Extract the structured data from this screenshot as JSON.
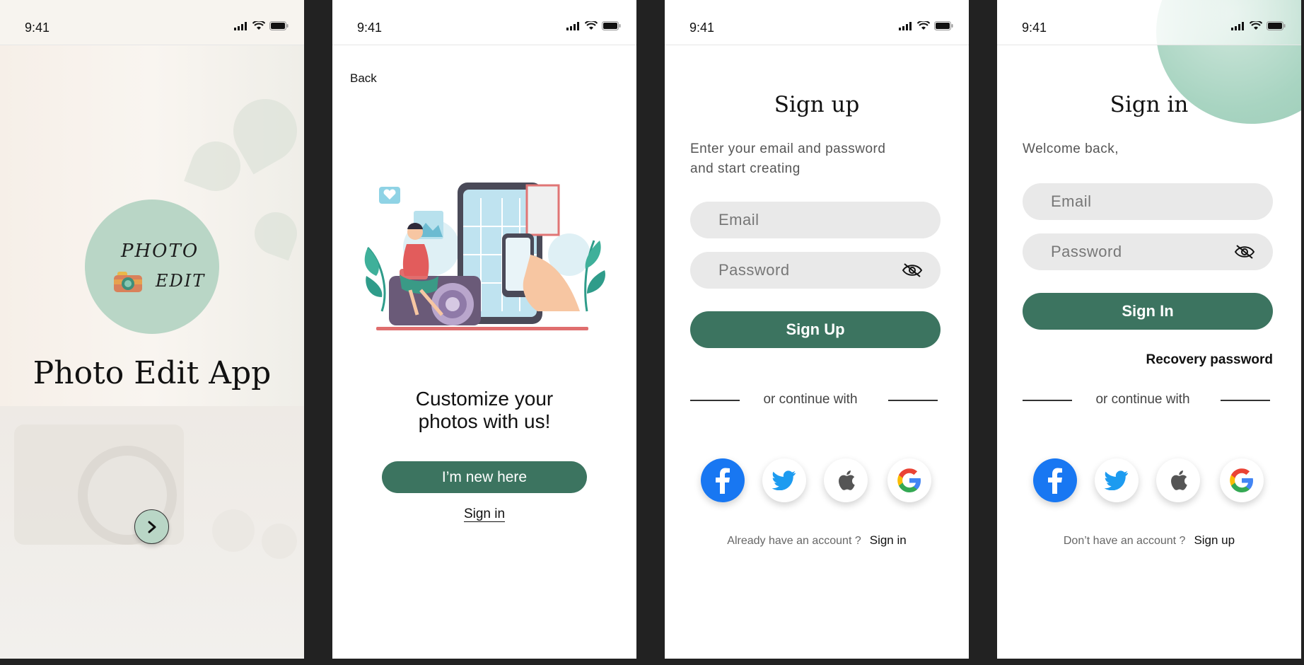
{
  "status_bar": {
    "time": "9:41"
  },
  "splash": {
    "logo_line1": "PHOTO",
    "logo_line2": "EDIT",
    "app_title": "Photo Edit App",
    "next_icon": "chevron-right-icon"
  },
  "onboarding": {
    "back_label": "Back",
    "headline_line1": "Customize your",
    "headline_line2": "photos with us!",
    "new_button": "I’m new here",
    "signin_link": "Sign in"
  },
  "signup": {
    "title": "Sign up",
    "subtitle_line1": "Enter your email and password",
    "subtitle_line2": "and start creating",
    "email_placeholder": "Email",
    "password_placeholder": "Password",
    "button": "Sign Up",
    "divider": "or continue with",
    "footer_text": "Already have an account ?",
    "footer_link": "Sign in"
  },
  "signin": {
    "title": "Sign in",
    "subtitle": "Welcome back,",
    "email_placeholder": "Email",
    "password_placeholder": "Password",
    "button": "Sign In",
    "recovery": "Recovery password",
    "divider": "or continue with",
    "footer_text": "Don’t have an account ?",
    "footer_link": "Sign up"
  },
  "social_providers": [
    "facebook-icon",
    "twitter-icon",
    "apple-icon",
    "google-icon"
  ],
  "colors": {
    "primary": "#3c7460",
    "accent_mint": "#b9d6c6",
    "background": "#222222",
    "field": "#e9e9e9"
  }
}
